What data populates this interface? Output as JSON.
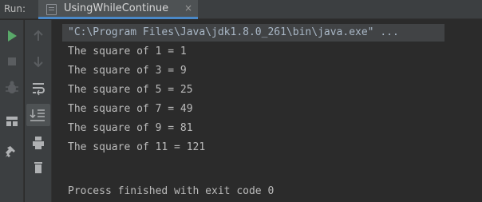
{
  "tabbar": {
    "run_label": "Run:",
    "tab_title": "UsingWhileContinue",
    "close_glyph": "×"
  },
  "toolbar": {
    "left": [
      "run-icon",
      "stop-icon",
      "bug-icon",
      "layout-icon",
      "pin-icon"
    ],
    "second": [
      "up-arrow-icon",
      "down-arrow-icon",
      "soft-wrap-icon",
      "scroll-to-end-icon",
      "print-icon",
      "trash-icon"
    ],
    "colors": {
      "run": "#59a869",
      "active_bg": "#4e5254"
    }
  },
  "console": {
    "command": "\"C:\\Program Files\\Java\\jdk1.8.0_261\\bin\\java.exe\" ...",
    "lines": [
      "The square of 1 = 1",
      "The square of 3 = 9",
      "The square of 5 = 25",
      "The square of 7 = 49",
      "The square of 9 = 81",
      "The square of 11 = 121"
    ],
    "exit": "Process finished with exit code 0"
  }
}
